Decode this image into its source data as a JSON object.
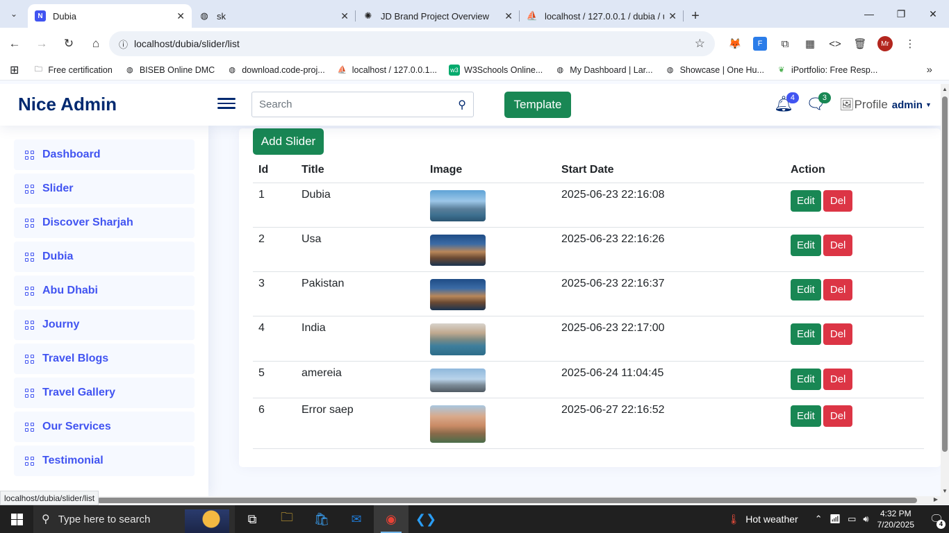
{
  "browser": {
    "tabs": [
      {
        "title": "Dubia",
        "active": true,
        "icon": "admin-favicon-icon"
      },
      {
        "title": "sk",
        "active": false,
        "icon": "globe-icon"
      },
      {
        "title": "JD Brand Project Overview",
        "active": false,
        "icon": "openai-icon"
      },
      {
        "title": "localhost / 127.0.0.1 / dubia / u",
        "active": false,
        "icon": "phpmyadmin-icon"
      }
    ],
    "url": "localhost/dubia/slider/list",
    "profile_initials": "Mr",
    "bookmarks": [
      {
        "label": "Free certification",
        "icon": "folder-icon"
      },
      {
        "label": "BISEB Online DMC",
        "icon": "globe-icon"
      },
      {
        "label": "download.code-proj...",
        "icon": "globe-icon"
      },
      {
        "label": "localhost / 127.0.0.1...",
        "icon": "phpmyadmin-icon"
      },
      {
        "label": "W3Schools Online...",
        "icon": "w3schools-icon"
      },
      {
        "label": "My Dashboard | Lar...",
        "icon": "globe-icon"
      },
      {
        "label": "Showcase | One Hu...",
        "icon": "globe-icon"
      },
      {
        "label": "iPortfolio: Free Resp...",
        "icon": "leaf-icon"
      }
    ],
    "status_url": "localhost/dubia/slider/list"
  },
  "header": {
    "logo": "Nice Admin",
    "search_placeholder": "Search",
    "template_button": "Template",
    "notifications_count": "4",
    "messages_count": "3",
    "profile_img_alt": "Profile",
    "profile_name": "admin"
  },
  "sidebar": {
    "items": [
      {
        "label": "Dashboard"
      },
      {
        "label": "Slider"
      },
      {
        "label": "Discover Sharjah"
      },
      {
        "label": "Dubia"
      },
      {
        "label": "Abu Dhabi"
      },
      {
        "label": "Journy"
      },
      {
        "label": "Travel Blogs"
      },
      {
        "label": "Travel Gallery"
      },
      {
        "label": "Our Services"
      },
      {
        "label": "Testimonial"
      }
    ]
  },
  "main": {
    "add_button": "Add Slider",
    "columns": [
      "Id",
      "Title",
      "Image",
      "Start Date",
      "Action"
    ],
    "edit_label": "Edit",
    "delete_label": "Del",
    "rows": [
      {
        "id": "1",
        "title": "Dubia",
        "start_date": "2025-06-23 22:16:08",
        "image": "skyline"
      },
      {
        "id": "2",
        "title": "Usa",
        "start_date": "2025-06-23 22:16:26",
        "image": "palace"
      },
      {
        "id": "3",
        "title": "Pakistan",
        "start_date": "2025-06-23 22:16:37",
        "image": "palace"
      },
      {
        "id": "4",
        "title": "India",
        "start_date": "2025-06-23 22:17:00",
        "image": "coast"
      },
      {
        "id": "5",
        "title": "amereia",
        "start_date": "2025-06-24 11:04:45",
        "image": "museum"
      },
      {
        "id": "6",
        "title": "Error saep",
        "start_date": "2025-06-27 22:16:52",
        "image": "atlantis"
      }
    ]
  },
  "taskbar": {
    "search_placeholder": "Type here to search",
    "weather": "Hot weather",
    "time": "4:32 PM",
    "date": "7/20/2025",
    "notification_count": "4"
  },
  "colors": {
    "brand": "#012970",
    "accent": "#4154f1",
    "success": "#198754",
    "danger": "#dc3545"
  }
}
